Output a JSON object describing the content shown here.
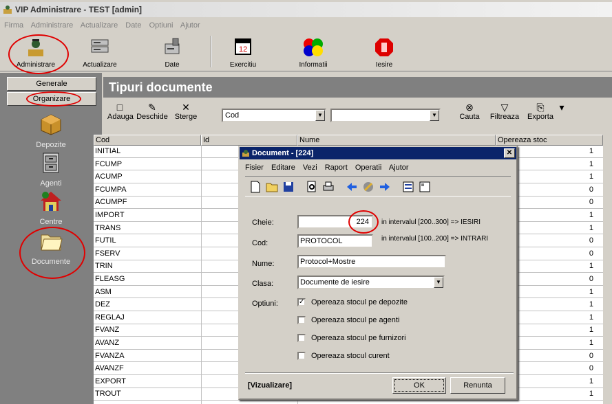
{
  "app": {
    "title": "VIP Administrare - TEST [admin]"
  },
  "menu": [
    "Firma",
    "Administrare",
    "Actualizare",
    "Date",
    "Optiuni",
    "Ajutor"
  ],
  "toolbar": {
    "items": [
      "Administrare",
      "Actualizare",
      "Date",
      "Exercitiu",
      "Informatii",
      "Iesire"
    ]
  },
  "sidebar": {
    "tabs": [
      "Generale",
      "Organizare"
    ],
    "items": [
      "Depozite",
      "Agenti",
      "Centre",
      "Documente"
    ]
  },
  "main": {
    "title": "Tipuri documente",
    "buttons": [
      "Adauga",
      "Deschide",
      "Sterge",
      "Cauta",
      "Filtreaza",
      "Exporta"
    ],
    "filter_field": "Cod",
    "filter_value": "",
    "columns": [
      "Cod",
      "Id",
      "Nume",
      "Opereaza stoc"
    ],
    "rows": [
      {
        "cod": "INITIAL",
        "stoc": "1"
      },
      {
        "cod": "FCUMP",
        "stoc": "1"
      },
      {
        "cod": "ACUMP",
        "stoc": "1"
      },
      {
        "cod": "FCUMPA",
        "stoc": "0"
      },
      {
        "cod": "ACUMPF",
        "stoc": "0"
      },
      {
        "cod": "IMPORT",
        "stoc": "1"
      },
      {
        "cod": "TRANS",
        "stoc": "1"
      },
      {
        "cod": "FUTIL",
        "stoc": "0"
      },
      {
        "cod": "FSERV",
        "stoc": "0"
      },
      {
        "cod": "TRIN",
        "stoc": "1"
      },
      {
        "cod": "FLEASG",
        "stoc": "0"
      },
      {
        "cod": "ASM",
        "stoc": "1"
      },
      {
        "cod": "DEZ",
        "stoc": "1"
      },
      {
        "cod": "REGLAJ",
        "stoc": "1"
      },
      {
        "cod": "FVANZ",
        "stoc": "1"
      },
      {
        "cod": "AVANZ",
        "stoc": "1"
      },
      {
        "cod": "FVANZA",
        "stoc": "0"
      },
      {
        "cod": "AVANZF",
        "stoc": "0"
      },
      {
        "cod": "EXPORT",
        "stoc": "1"
      },
      {
        "cod": "TROUT",
        "stoc": "1"
      }
    ]
  },
  "dialog": {
    "title": "Document - [224]",
    "menu": [
      "Fisier",
      "Editare",
      "Vezi",
      "Raport",
      "Operatii",
      "Ajutor"
    ],
    "labels": {
      "cheie": "Cheie:",
      "cod": "Cod:",
      "nume": "Nume:",
      "clasa": "Clasa:",
      "optiuni": "Optiuni:"
    },
    "cheie": "224",
    "hint1": "in intervalul [200..300] => IESIRI",
    "hint2": "in intervalul [100..200] => INTRARI",
    "cod": "PROTOCOL",
    "nume": "Protocol+Mostre",
    "clasa": "Documente de iesire",
    "options": [
      {
        "label": "Opereaza stocul pe depozite",
        "checked": true
      },
      {
        "label": "Opereaza stocul pe agenti",
        "checked": false
      },
      {
        "label": "Opereaza stocul pe furnizori",
        "checked": false
      },
      {
        "label": "Opereaza stocul curent",
        "checked": false
      }
    ],
    "status": "[Vizualizare]",
    "ok": "OK",
    "cancel": "Renunta"
  },
  "colors": {
    "accent": "#0a246a",
    "highlight": "#e00000",
    "panel": "#808080",
    "face": "#d4d0c8"
  }
}
